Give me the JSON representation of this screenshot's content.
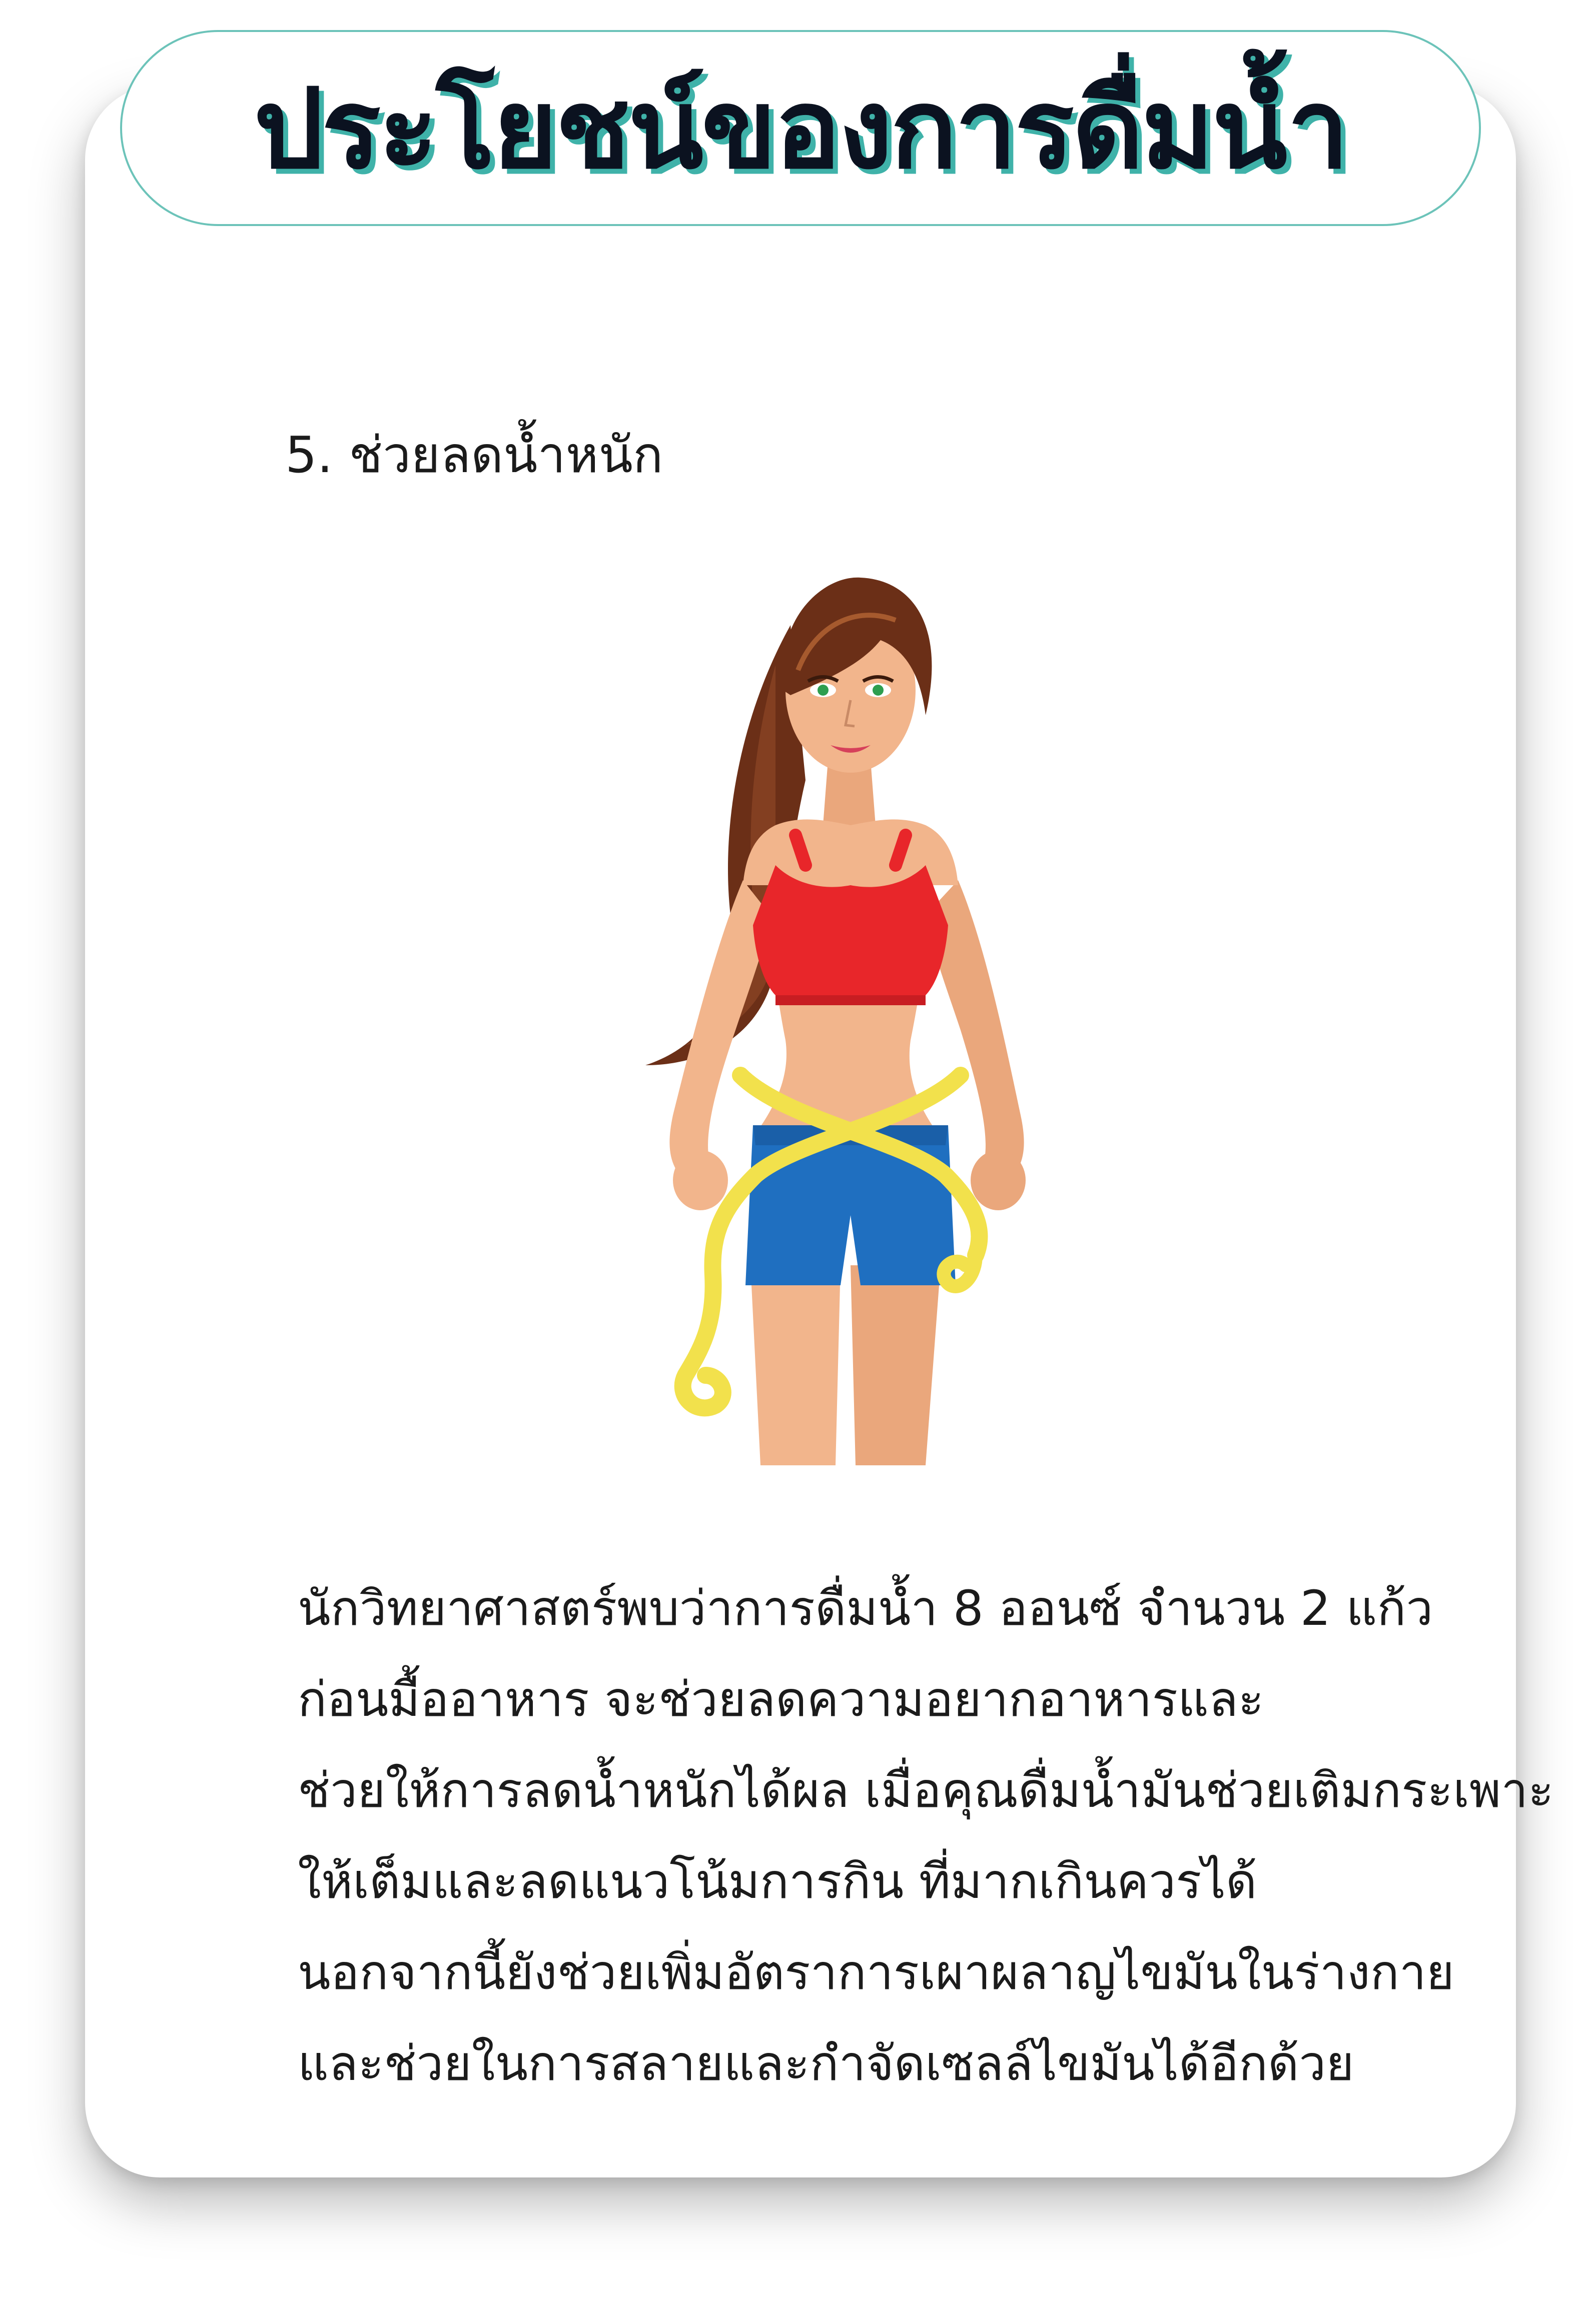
{
  "header": {
    "title": "ประโยชน์ของการดื่มน้ำ"
  },
  "section": {
    "heading": "5. ช่วยลดน้ำหนัก"
  },
  "illustration": {
    "icon": "woman-measuring-waist-illustration"
  },
  "body": {
    "lines": [
      "นักวิทยาศาสตร์พบว่าการดื่มน้ำ 8 ออนซ์ จำนวน 2 แก้ว",
      "ก่อนมื้ออาหาร จะช่วยลดความอยากอาหารและ",
      "ช่วยให้การลดน้ำหนักได้ผล เมื่อคุณดื่มน้ำมันช่วยเติมกระเพาะ",
      "ให้เต็มและลดแนวโน้มการกิน ที่มากเกินควรได้",
      "นอกจากนี้ยังช่วยเพิ่มอัตราการเผาผลาญไขมันในร่างกาย",
      "และช่วยในการสลายและกำจัดเซลล์ไขมันได้อีกด้วย"
    ]
  },
  "colors": {
    "title_text": "#0b1220",
    "title_shadow": "#3fb2a9",
    "pill_border": "#6cc3b9",
    "top": "#e8262a",
    "shorts": "#1f6fc0",
    "tape": "#f2e14c",
    "skin": "#f2b58c",
    "hair": "#6b2f17"
  }
}
